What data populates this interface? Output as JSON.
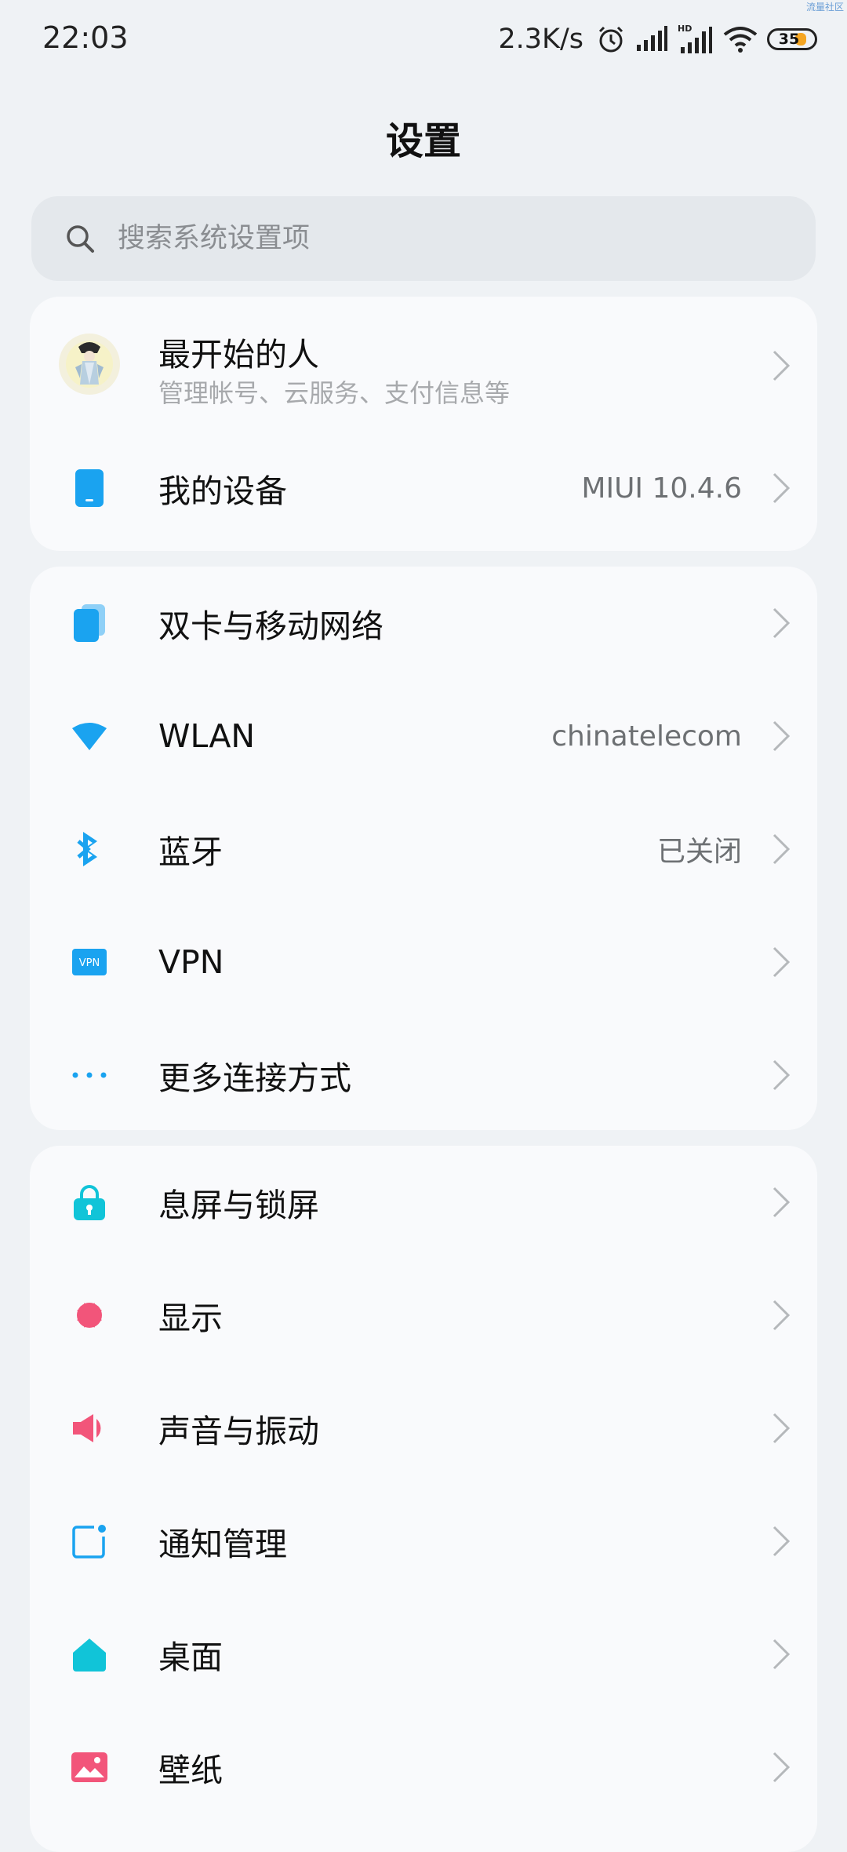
{
  "status_bar": {
    "time": "22:03",
    "net_speed": "2.3K/s",
    "battery": "35",
    "watermark": "流量社区",
    "icons": [
      "alarm-icon",
      "signal-icon",
      "hd-signal-icon",
      "wifi-icon",
      "battery-icon"
    ]
  },
  "title": "设置",
  "search": {
    "placeholder": "搜索系统设置项"
  },
  "account": {
    "name": "最开始的人",
    "subtitle": "管理帐号、云服务、支付信息等"
  },
  "my_device": {
    "label": "我的设备",
    "value": "MIUI 10.4.6"
  },
  "network": [
    {
      "label": "双卡与移动网络",
      "value": "",
      "icon": "sim-card-icon"
    },
    {
      "label": "WLAN",
      "value": "chinatelecom",
      "icon": "wifi-icon"
    },
    {
      "label": "蓝牙",
      "value": "已关闭",
      "icon": "bluetooth-icon"
    },
    {
      "label": "VPN",
      "value": "",
      "icon": "vpn-icon"
    },
    {
      "label": "更多连接方式",
      "value": "",
      "icon": "more-dots-icon"
    }
  ],
  "personal": [
    {
      "label": "息屏与锁屏",
      "icon": "lock-icon"
    },
    {
      "label": "显示",
      "icon": "display-icon"
    },
    {
      "label": "声音与振动",
      "icon": "speaker-icon"
    },
    {
      "label": "通知管理",
      "icon": "notification-icon"
    },
    {
      "label": "桌面",
      "icon": "home-icon"
    },
    {
      "label": "壁纸",
      "icon": "wallpaper-icon"
    }
  ],
  "colors": {
    "blue_accent": "#1aa3f0",
    "cyan_accent": "#11c4d8",
    "pink_accent": "#f2557a",
    "background": "#eff2f5",
    "card": "#f9fafc"
  }
}
